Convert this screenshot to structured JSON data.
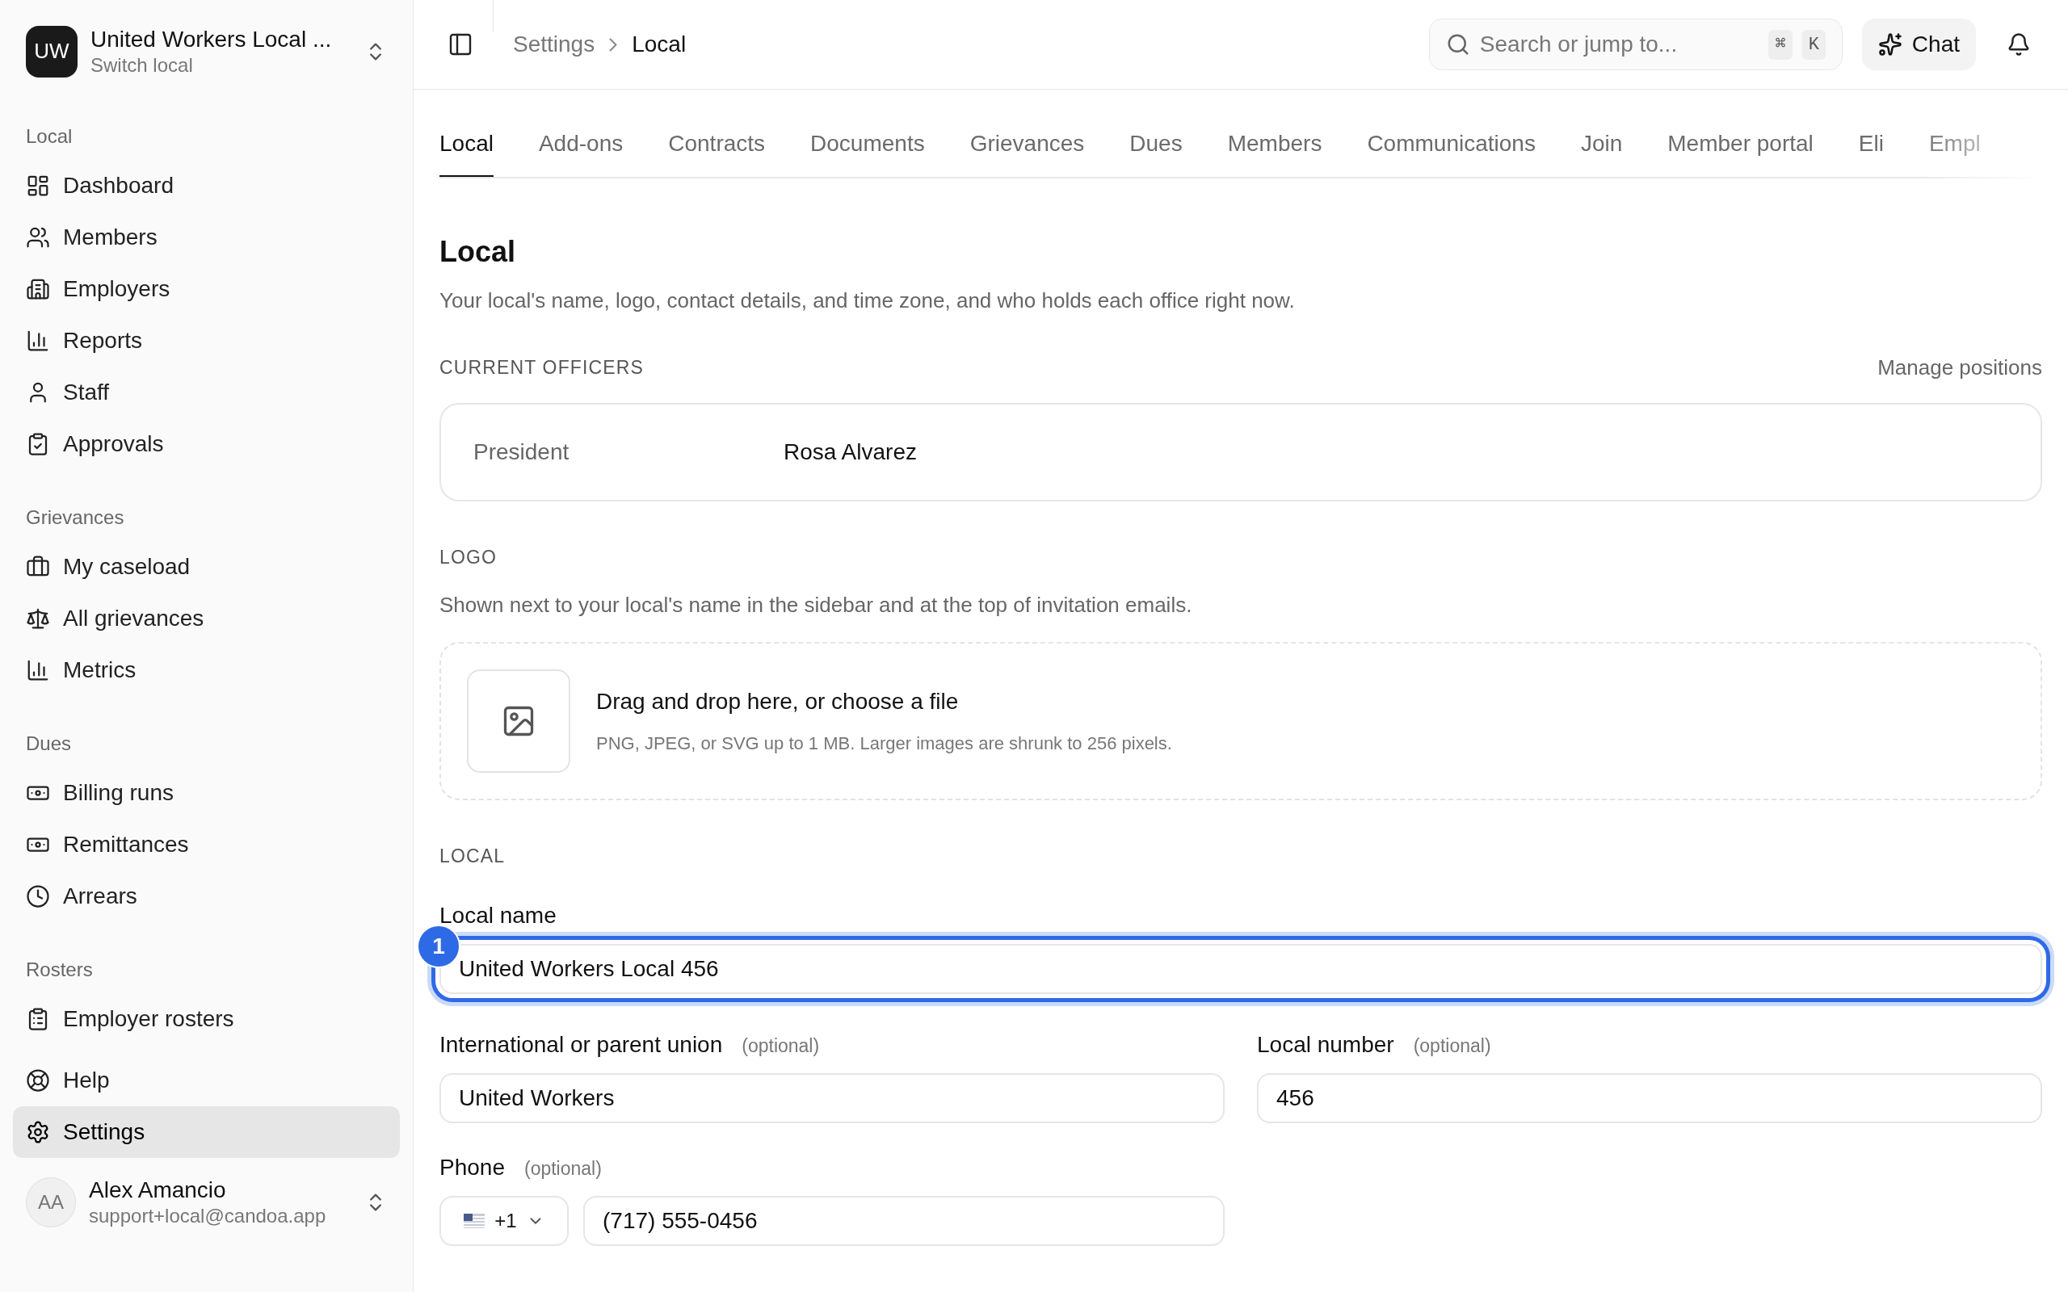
{
  "sidebar": {
    "org": {
      "initials": "UW",
      "name": "United Workers Local ...",
      "subtitle": "Switch local"
    },
    "sections": [
      {
        "title": "Local",
        "items": [
          {
            "label": "Dashboard",
            "selected": false
          },
          {
            "label": "Members",
            "selected": false
          },
          {
            "label": "Employers",
            "selected": false
          },
          {
            "label": "Reports",
            "selected": false
          },
          {
            "label": "Staff",
            "selected": false
          },
          {
            "label": "Approvals",
            "selected": false
          }
        ]
      },
      {
        "title": "Grievances",
        "items": [
          {
            "label": "My caseload",
            "selected": false
          },
          {
            "label": "All grievances",
            "selected": false
          },
          {
            "label": "Metrics",
            "selected": false
          }
        ]
      },
      {
        "title": "Dues",
        "items": [
          {
            "label": "Billing runs",
            "selected": false
          },
          {
            "label": "Remittances",
            "selected": false
          },
          {
            "label": "Arrears",
            "selected": false
          }
        ]
      },
      {
        "title": "Rosters",
        "items": [
          {
            "label": "Employer rosters",
            "selected": false
          }
        ]
      }
    ],
    "footer_items": [
      {
        "label": "Help",
        "selected": false
      },
      {
        "label": "Settings",
        "selected": true
      }
    ],
    "user": {
      "initials": "AA",
      "name": "Alex Amancio",
      "email": "support+local@candoa.app"
    }
  },
  "header": {
    "breadcrumb": [
      "Settings",
      "Local"
    ],
    "search": {
      "placeholder": "Search or jump to...",
      "shortcut": [
        "⌘",
        "K"
      ]
    },
    "chat_button": "Chat"
  },
  "tabs": [
    {
      "label": "Local",
      "selected": true
    },
    {
      "label": "Add-ons",
      "selected": false
    },
    {
      "label": "Contracts",
      "selected": false
    },
    {
      "label": "Documents",
      "selected": false
    },
    {
      "label": "Grievances",
      "selected": false
    },
    {
      "label": "Dues",
      "selected": false
    },
    {
      "label": "Members",
      "selected": false
    },
    {
      "label": "Communications",
      "selected": false
    },
    {
      "label": "Join",
      "selected": false
    },
    {
      "label": "Member portal",
      "selected": false
    },
    {
      "label": "Eli",
      "selected": false
    },
    {
      "label": "Empl",
      "selected": false
    }
  ],
  "page": {
    "title": "Local",
    "description": "Your local's name, logo, contact details, and time zone, and who holds each office right now."
  },
  "officers": {
    "heading": "CURRENT OFFICERS",
    "action": "Manage positions",
    "rows": [
      {
        "role": "President",
        "name": "Rosa Alvarez"
      }
    ]
  },
  "logo": {
    "heading": "LOGO",
    "description": "Shown next to your local's name in the sidebar and at the top of invitation emails.",
    "dropzone": {
      "title": "Drag and drop here, or choose a file",
      "hint": "PNG, JPEG, or SVG up to 1 MB. Larger images are shrunk to 256 pixels."
    }
  },
  "local": {
    "heading": "LOCAL",
    "name_field": {
      "label": "Local name",
      "value": "United Workers Local 456",
      "focused": true,
      "annotation": "1"
    },
    "row_fields": [
      {
        "label": "International or parent union",
        "optional": "(optional)",
        "value": "United Workers"
      },
      {
        "label": "Local number",
        "optional": "(optional)",
        "value": "456"
      }
    ],
    "phone": {
      "label": "Phone",
      "optional": "(optional)",
      "country_code": "+1",
      "value": "(717) 555-0456"
    }
  }
}
